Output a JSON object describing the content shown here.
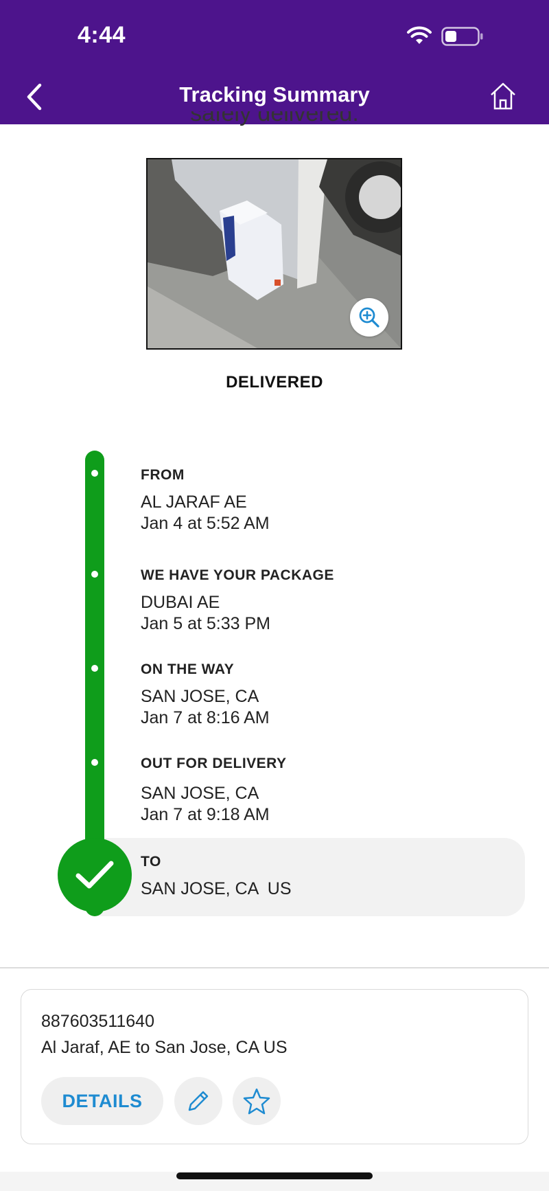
{
  "status_bar": {
    "time": "4:44",
    "icons": [
      "wifi-icon",
      "battery-icon"
    ]
  },
  "header": {
    "title": "Tracking Summary",
    "back_icon": "chevron-left-icon",
    "home_icon": "home-icon",
    "background_color": "#4d148c"
  },
  "content": {
    "partial_message": "safely delivered.",
    "photo_zoom_icon": "zoom-in-icon",
    "status_label": "DELIVERED"
  },
  "timeline": {
    "color": "#0f9d1b",
    "events": [
      {
        "title": "FROM",
        "location": "AL JARAF AE",
        "time": "Jan 4 at 5:52 AM"
      },
      {
        "title": "WE HAVE YOUR PACKAGE",
        "location": "DUBAI AE",
        "time": "Jan 5 at 5:33 PM"
      },
      {
        "title": "ON THE WAY",
        "location": "SAN JOSE, CA",
        "time": "Jan 7 at 8:16 AM"
      },
      {
        "title": "OUT FOR DELIVERY",
        "location": "SAN JOSE, CA",
        "time": "Jan 7 at 9:18 AM"
      },
      {
        "title": "TO",
        "location": "SAN JOSE, CA  US"
      }
    ],
    "final_icon": "checkmark-icon"
  },
  "summary_card": {
    "tracking_number": "887603511640",
    "route": "Al Jaraf, AE to San Jose, CA US",
    "details_label": "DETAILS",
    "edit_icon": "pencil-icon",
    "favorite_icon": "star-icon",
    "accent_color": "#1e8bd1"
  }
}
